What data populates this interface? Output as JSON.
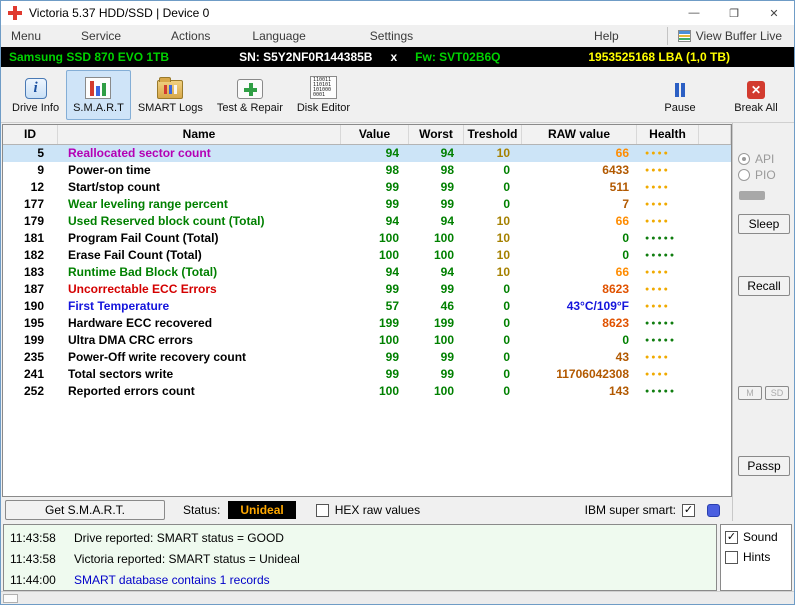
{
  "colors": {
    "model_green": "#00d200",
    "capacity_yellow": "#ffff00",
    "status_orange": "#ffa800",
    "value_green": "#008000",
    "selected_row": "#cce4f7",
    "log_bg": "#effaef"
  },
  "window": {
    "title": "Victoria 5.37 HDD/SSD | Device 0",
    "minimize": "—",
    "maximize": "❐",
    "close": "✕"
  },
  "menubar": {
    "items": [
      "Menu",
      "Service",
      "Actions",
      "Language",
      "Settings",
      "Help"
    ],
    "view_buffer": "View Buffer Live"
  },
  "infobar": {
    "model": "Samsung SSD 870 EVO 1TB",
    "serial": "SN: S5Y2NF0R144385B",
    "x": "x",
    "firmware": "Fw: SVT02B6Q",
    "capacity": "1953525168 LBA (1,0 TB)"
  },
  "toolbar": {
    "drive_info": "Drive Info",
    "smart": "S.M.A.R.T",
    "smart_logs": "SMART Logs",
    "test_repair": "Test & Repair",
    "disk_editor": "Disk Editor",
    "pause": "Pause",
    "break_all": "Break All"
  },
  "table": {
    "headers": [
      "ID",
      "Name",
      "Value",
      "Worst",
      "Treshold",
      "RAW value",
      "Health"
    ],
    "rows": [
      {
        "id": "5",
        "name": "Reallocated sector count",
        "name_color": "#b400b4",
        "value": "94",
        "worst": "94",
        "threshold": "10",
        "threshold_color": "#a58000",
        "raw": "66",
        "raw_color": "#ff8c00",
        "dots": 4,
        "dot_color": "#f0aa00",
        "selected": true
      },
      {
        "id": "9",
        "name": "Power-on time",
        "name_color": "#000000",
        "value": "98",
        "worst": "98",
        "threshold": "0",
        "threshold_color": "#008000",
        "raw": "6433",
        "raw_color": "#b25900",
        "dots": 4,
        "dot_color": "#f0aa00",
        "selected": false
      },
      {
        "id": "12",
        "name": "Start/stop count",
        "name_color": "#000000",
        "value": "99",
        "worst": "99",
        "threshold": "0",
        "threshold_color": "#008000",
        "raw": "511",
        "raw_color": "#b25900",
        "dots": 4,
        "dot_color": "#f0aa00",
        "selected": false
      },
      {
        "id": "177",
        "name": "Wear leveling range percent",
        "name_color": "#008000",
        "value": "99",
        "worst": "99",
        "threshold": "0",
        "threshold_color": "#008000",
        "raw": "7",
        "raw_color": "#b25900",
        "dots": 4,
        "dot_color": "#f0aa00",
        "selected": false
      },
      {
        "id": "179",
        "name": "Used Reserved block count (Total)",
        "name_color": "#008000",
        "value": "94",
        "worst": "94",
        "threshold": "10",
        "threshold_color": "#a58000",
        "raw": "66",
        "raw_color": "#ff8c00",
        "dots": 4,
        "dot_color": "#f0aa00",
        "selected": false
      },
      {
        "id": "181",
        "name": "Program Fail Count (Total)",
        "name_color": "#000000",
        "value": "100",
        "worst": "100",
        "threshold": "10",
        "threshold_color": "#a58000",
        "raw": "0",
        "raw_color": "#008000",
        "dots": 5,
        "dot_color": "#0f7d0f",
        "selected": false
      },
      {
        "id": "182",
        "name": "Erase Fail Count (Total)",
        "name_color": "#000000",
        "value": "100",
        "worst": "100",
        "threshold": "10",
        "threshold_color": "#a58000",
        "raw": "0",
        "raw_color": "#008000",
        "dots": 5,
        "dot_color": "#0f7d0f",
        "selected": false
      },
      {
        "id": "183",
        "name": "Runtime Bad Block (Total)",
        "name_color": "#008000",
        "value": "94",
        "worst": "94",
        "threshold": "10",
        "threshold_color": "#a58000",
        "raw": "66",
        "raw_color": "#ff8c00",
        "dots": 4,
        "dot_color": "#f0aa00",
        "selected": false
      },
      {
        "id": "187",
        "name": "Uncorrectable ECC Errors",
        "name_color": "#d40000",
        "value": "99",
        "worst": "99",
        "threshold": "0",
        "threshold_color": "#008000",
        "raw": "8623",
        "raw_color": "#e05200",
        "dots": 4,
        "dot_color": "#f0aa00",
        "selected": false
      },
      {
        "id": "190",
        "name": "First Temperature",
        "name_color": "#1414dc",
        "value": "57",
        "worst": "46",
        "threshold": "0",
        "threshold_color": "#008000",
        "raw": "43°C/109°F",
        "raw_color": "#1414dc",
        "dots": 4,
        "dot_color": "#f0aa00",
        "selected": false
      },
      {
        "id": "195",
        "name": "Hardware ECC recovered",
        "name_color": "#000000",
        "value": "199",
        "worst": "199",
        "threshold": "0",
        "threshold_color": "#008000",
        "raw": "8623",
        "raw_color": "#e05200",
        "dots": 5,
        "dot_color": "#0f7d0f",
        "selected": false
      },
      {
        "id": "199",
        "name": "Ultra DMA CRC errors",
        "name_color": "#000000",
        "value": "100",
        "worst": "100",
        "threshold": "0",
        "threshold_color": "#008000",
        "raw": "0",
        "raw_color": "#008000",
        "dots": 5,
        "dot_color": "#0f7d0f",
        "selected": false
      },
      {
        "id": "235",
        "name": "Power-Off write recovery count",
        "name_color": "#000000",
        "value": "99",
        "worst": "99",
        "threshold": "0",
        "threshold_color": "#008000",
        "raw": "43",
        "raw_color": "#b25900",
        "dots": 4,
        "dot_color": "#f0aa00",
        "selected": false
      },
      {
        "id": "241",
        "name": "Total sectors write",
        "name_color": "#000000",
        "value": "99",
        "worst": "99",
        "threshold": "0",
        "threshold_color": "#008000",
        "raw": "11706042308",
        "raw_color": "#b25900",
        "dots": 4,
        "dot_color": "#f0aa00",
        "selected": false
      },
      {
        "id": "252",
        "name": "Reported errors count",
        "name_color": "#000000",
        "value": "100",
        "worst": "100",
        "threshold": "0",
        "threshold_color": "#008000",
        "raw": "143",
        "raw_color": "#b25900",
        "dots": 5,
        "dot_color": "#0f7d0f",
        "selected": false
      }
    ]
  },
  "bottom": {
    "get_smart": "Get S.M.A.R.T.",
    "status_label": "Status:",
    "status_value": "Unideal",
    "hex_label": "HEX raw values",
    "ibm_label": "IBM super smart:"
  },
  "right_panel": {
    "api": "API",
    "pio": "PIO",
    "sleep": "Sleep",
    "recall": "Recall",
    "small1": "M",
    "small2": "SD",
    "passp": "Passp"
  },
  "log": {
    "lines": [
      {
        "time": "11:43:58",
        "text": "Drive reported: SMART status = GOOD",
        "color": "#000000"
      },
      {
        "time": "11:43:58",
        "text": "Victoria reported: SMART status = Unideal",
        "color": "#000000"
      },
      {
        "time": "11:44:00",
        "text": "SMART database contains 1 records",
        "color": "#0000c8"
      }
    ]
  },
  "side": {
    "sound": "Sound",
    "hints": "Hints"
  }
}
